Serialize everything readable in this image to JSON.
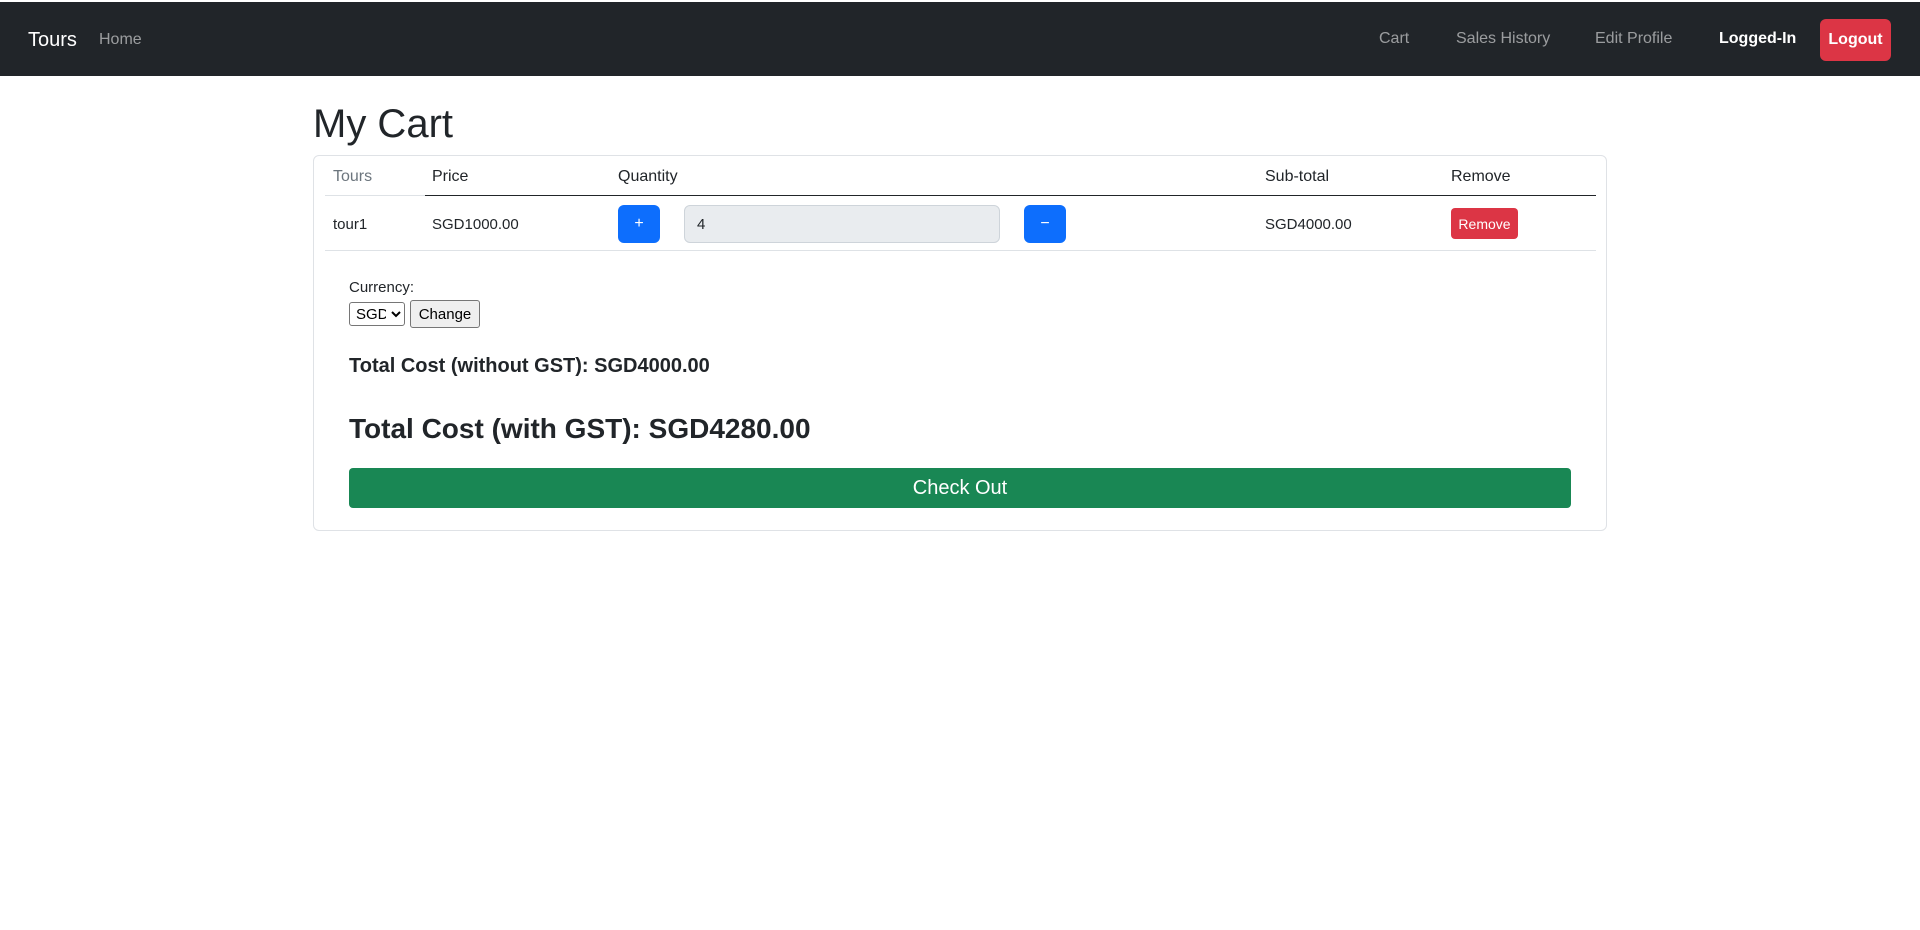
{
  "navbar": {
    "brand": "Tours",
    "home": "Home",
    "cart": "Cart",
    "sales_history": "Sales History",
    "edit_profile": "Edit Profile",
    "status": "Logged-In",
    "logout": "Logout"
  },
  "page": {
    "title": "My Cart"
  },
  "table": {
    "headers": {
      "tours": "Tours",
      "price": "Price",
      "quantity": "Quantity",
      "subtotal": "Sub-total",
      "remove": "Remove"
    },
    "rows": [
      {
        "name": "tour1",
        "price": "SGD1000.00",
        "increase_label": "+",
        "quantity": "4",
        "decrease_label": "−",
        "subtotal": "SGD4000.00",
        "remove_label": "Remove"
      }
    ]
  },
  "currency": {
    "label": "Currency:",
    "selected": "SGD",
    "change_label": "Change"
  },
  "totals": {
    "without_gst": "Total Cost (without GST): SGD4000.00",
    "with_gst": "Total Cost (with GST): SGD4280.00"
  },
  "checkout": {
    "label": "Check Out"
  },
  "colors": {
    "navbar_bg": "#212529",
    "primary": "#0d6efd",
    "danger": "#dc3545",
    "success": "#198754"
  }
}
